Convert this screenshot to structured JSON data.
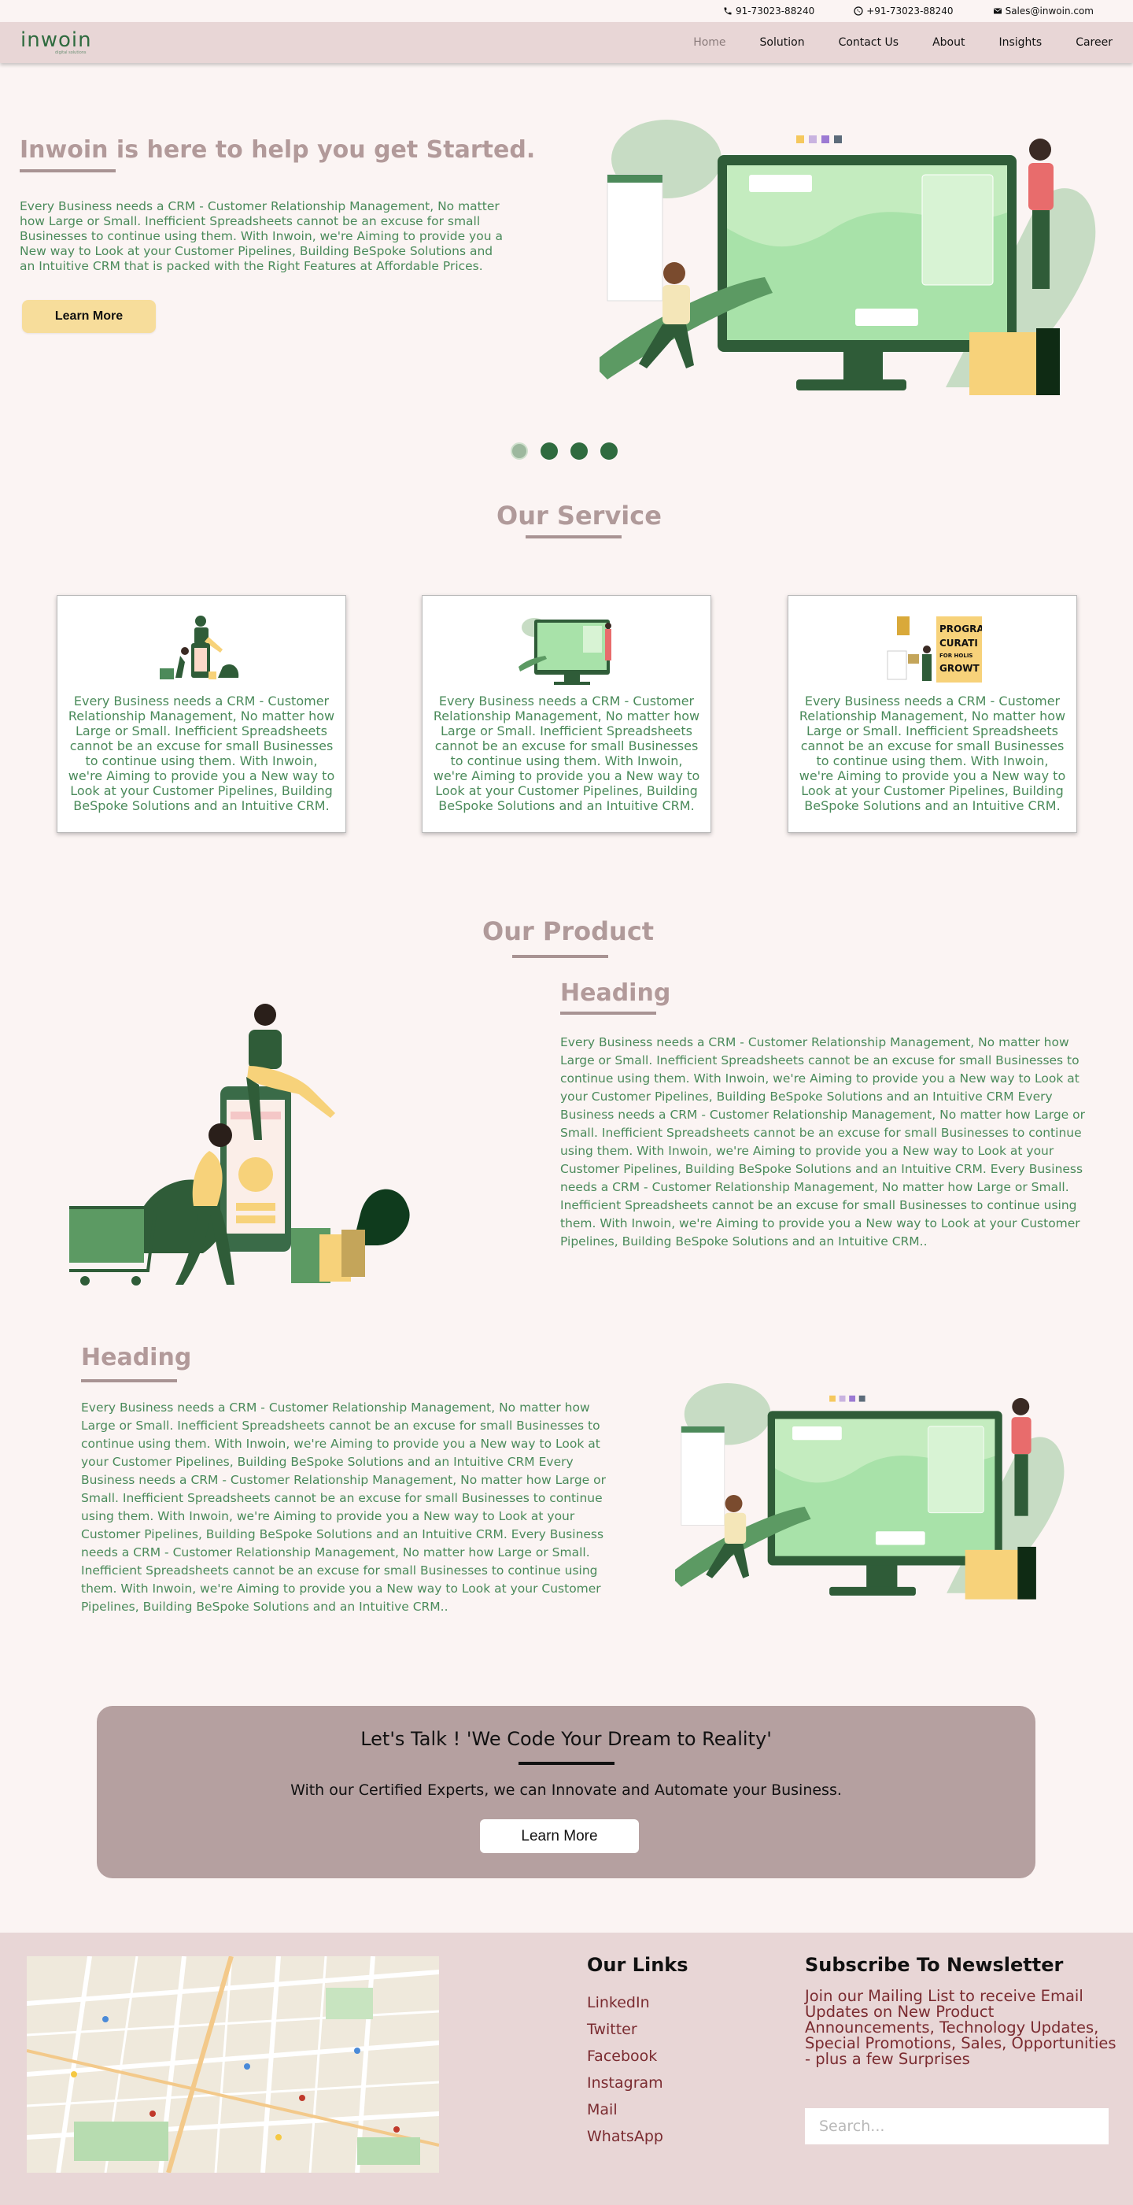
{
  "topbar": {
    "phone1": "91-73023-88240",
    "phone2": "+91-73023-88240",
    "email": "Sales@inwoin.com"
  },
  "nav": {
    "logo": "inwoin",
    "logo_tagline": "digital solutions",
    "links": [
      "Home",
      "Solution",
      "Contact Us",
      "About",
      "Insights",
      "Career"
    ],
    "active": "Home"
  },
  "hero": {
    "title": "Inwoin is here to help you get Started.",
    "text": "Every Business needs a CRM - Customer Relationship Management, No matter how Large or Small. Inefficient Spreadsheets cannot be an excuse for small Businesses to continue using them. With Inwoin, we're Aiming to provide you a New way to Look at your Customer Pipelines, Building BeSpoke Solutions and an Intuitive CRM that is packed with the Right Features at Affordable Prices.",
    "button": "Learn More",
    "slides": 4,
    "active_slide": 1
  },
  "services": {
    "title": "Our Service",
    "cards": [
      {
        "text": "Every Business needs a CRM - Customer Relationship Management, No matter how Large or Small. Inefficient Spreadsheets cannot be an excuse for small Businesses to continue using them. With Inwoin, we're Aiming to provide you a New way to Look at your Customer Pipelines, Building BeSpoke Solutions and an Intuitive CRM."
      },
      {
        "text": "Every Business needs a CRM - Customer Relationship Management, No matter how Large or Small. Inefficient Spreadsheets cannot be an excuse for small Businesses to continue using them. With Inwoin, we're Aiming to provide you a New way to Look at your Customer Pipelines, Building BeSpoke Solutions and an Intuitive CRM."
      },
      {
        "text": "Every Business needs a CRM - Customer Relationship Management, No matter how Large or Small. Inefficient Spreadsheets cannot be an excuse for small Businesses to continue using them. With Inwoin, we're Aiming to provide you a New way to Look at your Customer Pipelines, Building BeSpoke Solutions and an Intuitive CRM.",
        "image_text": [
          "PROGRA",
          "CURATI",
          "FOR HOLIS",
          "GROWT"
        ]
      }
    ]
  },
  "products": {
    "title": "Our Product",
    "items": [
      {
        "heading": "Heading",
        "text": "Every Business needs a CRM - Customer Relationship Management, No matter how Large or Small. Inefficient Spreadsheets cannot be an excuse for small Businesses to continue using them. With Inwoin, we're Aiming to provide you a New way to Look at your Customer Pipelines, Building BeSpoke Solutions and an Intuitive CRM Every Business needs a CRM - Customer Relationship Management, No matter how Large or Small. Inefficient Spreadsheets cannot be an excuse for small Businesses to continue using them. With Inwoin, we're Aiming to provide you a New way to Look at your Customer Pipelines, Building BeSpoke Solutions and an Intuitive CRM. Every Business needs a CRM - Customer Relationship Management, No matter how Large or Small. Inefficient Spreadsheets cannot be an excuse for small Businesses to continue using them. With Inwoin, we're Aiming to provide you a New way to Look at your Customer Pipelines, Building BeSpoke Solutions and an Intuitive CRM.."
      },
      {
        "heading": "Heading",
        "text": "Every Business needs a CRM - Customer Relationship Management, No matter how Large or Small. Inefficient Spreadsheets cannot be an excuse for small Businesses to continue using them. With Inwoin, we're Aiming to provide you a New way to Look at your Customer Pipelines, Building BeSpoke Solutions and an Intuitive CRM Every Business needs a CRM - Customer Relationship Management, No matter how Large or Small. Inefficient Spreadsheets cannot be an excuse for small Businesses to continue using them. With Inwoin, we're Aiming to provide you a New way to Look at your Customer Pipelines, Building BeSpoke Solutions and an Intuitive CRM. Every Business needs a CRM - Customer Relationship Management, No matter how Large or Small. Inefficient Spreadsheets cannot be an excuse for small Businesses to continue using them. With Inwoin, we're Aiming to provide you a New way to Look at your Customer Pipelines, Building BeSpoke Solutions and an Intuitive CRM.."
      }
    ]
  },
  "cta": {
    "title": "Let's Talk ! 'We Code Your Dream to Reality'",
    "subtitle": "With our Certified Experts, we can Innovate and Automate your Business.",
    "button": "Learn More"
  },
  "footer": {
    "links_title": "Our Links",
    "links": [
      "LinkedIn",
      "Twitter",
      "Facebook",
      "Instagram",
      "Mail",
      "WhatsApp"
    ],
    "newsletter_title": "Subscribe To Newsletter",
    "newsletter_text": "Join our Mailing List to receive Email Updates on New Product Announcements, Technology Updates, Special Promotions, Sales, Opportunities - plus a few Surprises",
    "search_placeholder": "Search..."
  },
  "colors": {
    "nav_bg": "#e8d6d6",
    "heading": "#b29a9a",
    "body_green": "#4a8a5a",
    "brand_green": "#2f6b3f",
    "button_yellow": "#f7dd9b",
    "cta_bg": "#b5a0a0",
    "link_red": "#7a2b30"
  }
}
